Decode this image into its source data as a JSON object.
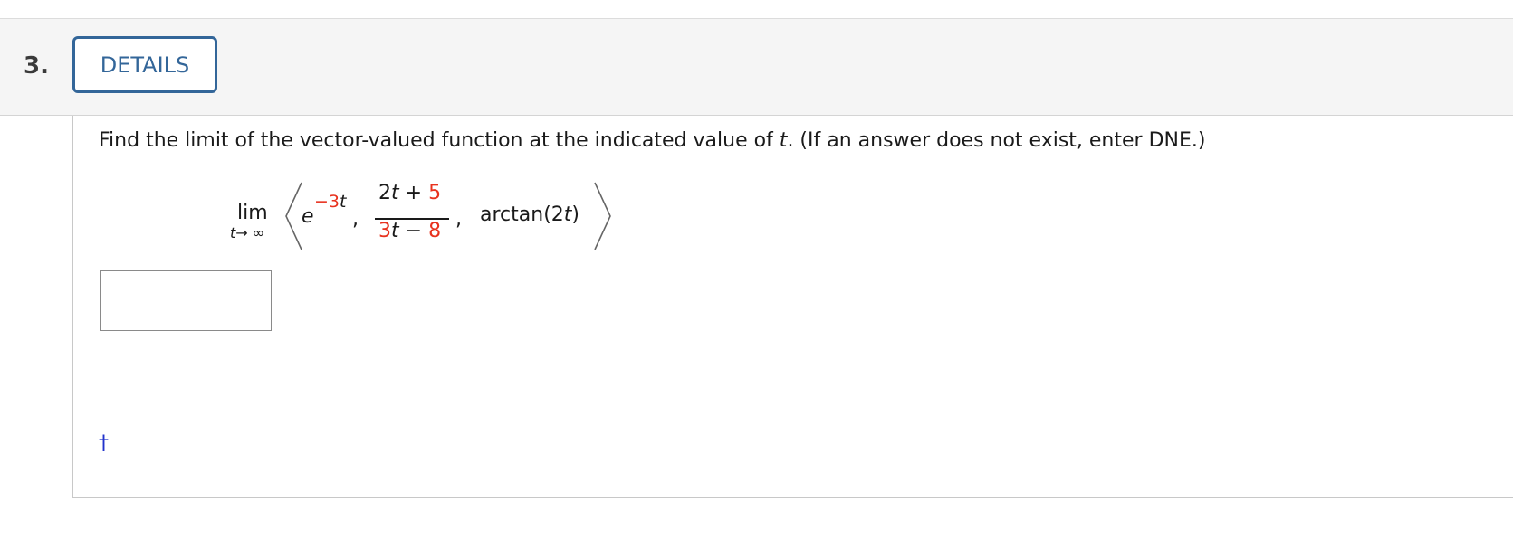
{
  "question": {
    "number": "3.",
    "details_label": "DETAILS"
  },
  "prompt": {
    "before_var": "Find the limit of the vector-valued function at the indicated value of ",
    "var": "t",
    "after_var": ". (If an answer does not exist, enter DNE.)"
  },
  "expression": {
    "lim": "lim",
    "lim_sub_var": "t",
    "lim_sub_rest": "→ ∞",
    "e_base": "e",
    "e_exp_sign": "−",
    "e_exp_coef": "3",
    "e_exp_var": "t",
    "num_coef": "2",
    "num_var": "t",
    "num_op": " + ",
    "num_const": "5",
    "den_coef": "3",
    "den_var": "t",
    "den_op": " − ",
    "den_const": "8",
    "arctan_open": "arctan(2",
    "arctan_var": "t",
    "arctan_close": ")",
    "comma": ","
  },
  "answer": {
    "value": ""
  },
  "footnote_symbol": "†",
  "colors": {
    "accent": "#336699",
    "highlight": "#e8321e",
    "link": "#2233cc"
  }
}
